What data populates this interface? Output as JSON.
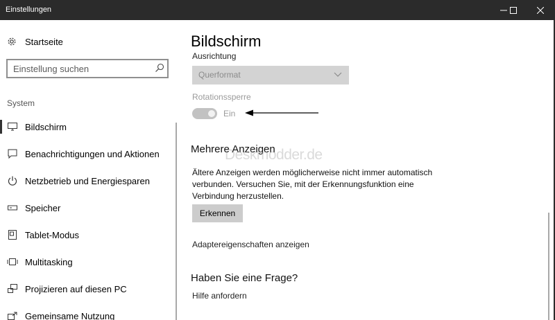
{
  "window": {
    "title": "Einstellungen"
  },
  "sidebar": {
    "home_label": "Startseite",
    "search_placeholder": "Einstellung suchen",
    "section_header": "System",
    "items": [
      {
        "label": "Bildschirm",
        "icon": "monitor-icon",
        "active": true
      },
      {
        "label": "Benachrichtigungen und Aktionen",
        "icon": "notification-icon",
        "active": false
      },
      {
        "label": "Netzbetrieb und Energiesparen",
        "icon": "power-icon",
        "active": false
      },
      {
        "label": "Speicher",
        "icon": "storage-icon",
        "active": false
      },
      {
        "label": "Tablet-Modus",
        "icon": "tablet-icon",
        "active": false
      },
      {
        "label": "Multitasking",
        "icon": "multitasking-icon",
        "active": false
      },
      {
        "label": "Projizieren auf diesen PC",
        "icon": "project-icon",
        "active": false
      },
      {
        "label": "Gemeinsame Nutzung",
        "icon": "share-icon",
        "active": false
      }
    ]
  },
  "main": {
    "page_title": "Bildschirm",
    "orientation": {
      "label": "Ausrichtung",
      "value": "Querformat"
    },
    "rotation_lock": {
      "label": "Rotationssperre",
      "state_text": "Ein",
      "enabled": false
    },
    "multi_display": {
      "heading": "Mehrere Anzeigen",
      "description_lines": [
        "Ältere Anzeigen werden möglicherweise nicht immer automatisch",
        "verbunden. Versuchen Sie, mit der Erkennungsfunktion eine",
        "Verbindung herzustellen."
      ],
      "detect_button": "Erkennen",
      "adapter_link": "Adaptereigenschaften anzeigen"
    },
    "question": {
      "heading": "Haben Sie eine Frage?",
      "help_link": "Hilfe anfordern"
    },
    "watermark": "Deskmodder.de"
  },
  "colors": {
    "titlebar": "#2b2b2b",
    "disabled_control": "#d3d3d3",
    "button": "#cccccc"
  }
}
